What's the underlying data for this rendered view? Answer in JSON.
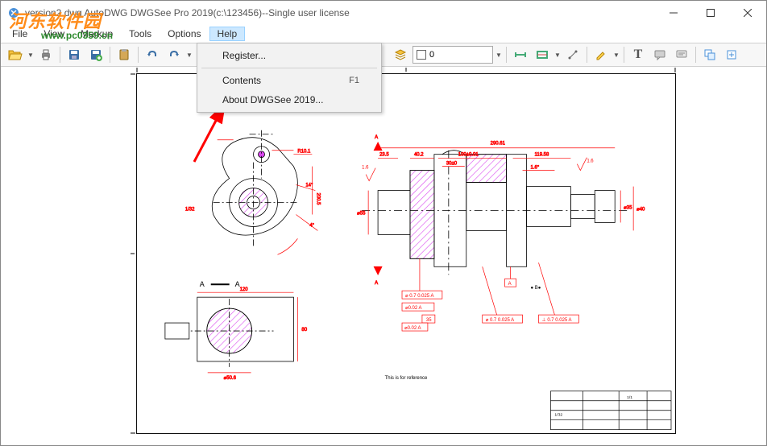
{
  "window": {
    "title": "version2.dwg AutoDWG DWGSee Pro 2019(c:\\123456)--Single user license"
  },
  "watermark": {
    "text1": "河东软件园",
    "text2": "www.pc0359.cn"
  },
  "menu": {
    "file": "File",
    "view": "View",
    "markup": "Markup",
    "tools": "Tools",
    "options": "Options",
    "help": "Help"
  },
  "help_menu": {
    "register": "Register...",
    "contents": "Contents",
    "contents_shortcut": "F1",
    "about": "About DWGSee 2019..."
  },
  "toolbar": {
    "layer_value": "0"
  },
  "drawing": {
    "labels": [
      "A",
      "A"
    ],
    "caption": "This is for reference"
  }
}
